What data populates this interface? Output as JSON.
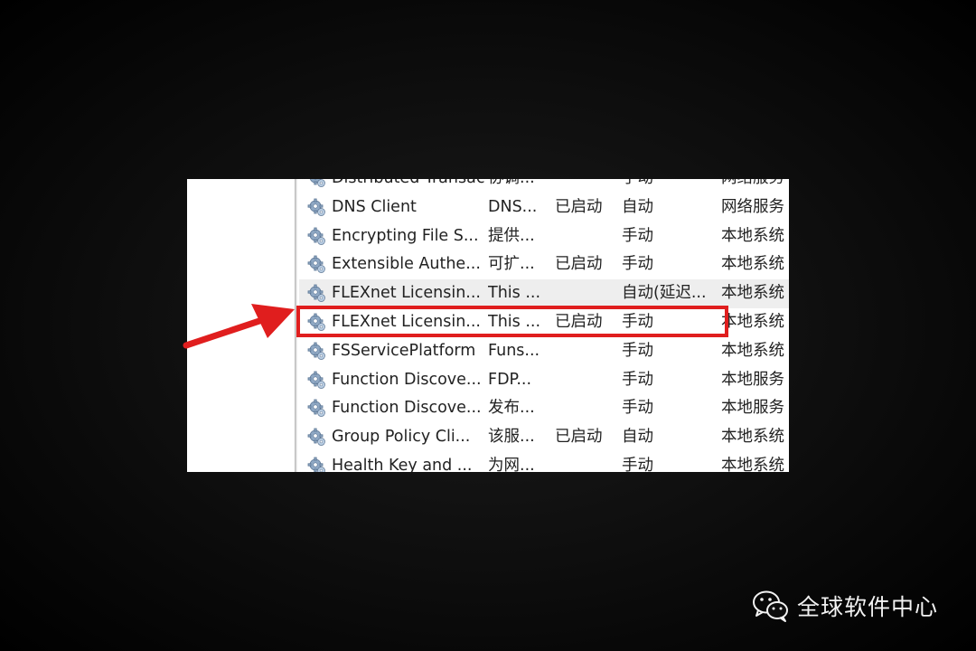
{
  "services": {
    "rows": [
      {
        "name": "Distributed Transaction...",
        "desc": "协调...",
        "status": "",
        "startup": "手动",
        "logon": "网络服务"
      },
      {
        "name": "DNS Client",
        "desc": "DNS...",
        "status": "已启动",
        "startup": "自动",
        "logon": "网络服务"
      },
      {
        "name": "Encrypting File S...",
        "desc": "提供...",
        "status": "",
        "startup": "手动",
        "logon": "本地系统"
      },
      {
        "name": "Extensible Authe...",
        "desc": "可扩...",
        "status": "已启动",
        "startup": "手动",
        "logon": "本地系统"
      },
      {
        "name": "FLEXnet Licensin...",
        "desc": "This ...",
        "status": "",
        "startup": "自动(延迟...",
        "logon": "本地系统"
      },
      {
        "name": "FLEXnet Licensin...",
        "desc": "This ...",
        "status": "已启动",
        "startup": "手动",
        "logon": "本地系统"
      },
      {
        "name": "FSServicePlatform",
        "desc": "Funs...",
        "status": "",
        "startup": "手动",
        "logon": "本地系统"
      },
      {
        "name": "Function Discove...",
        "desc": "FDP...",
        "status": "",
        "startup": "手动",
        "logon": "本地服务"
      },
      {
        "name": "Function Discove...",
        "desc": "发布...",
        "status": "",
        "startup": "手动",
        "logon": "本地服务"
      },
      {
        "name": "Group Policy Cli...",
        "desc": "该服...",
        "status": "已启动",
        "startup": "自动",
        "logon": "本地系统"
      },
      {
        "name": "Health Key and ...",
        "desc": "为网...",
        "status": "",
        "startup": "手动",
        "logon": "本地系统"
      }
    ]
  },
  "icons": {
    "service": "gear-icon",
    "pointer": "red-arrow-icon",
    "wechat": "wechat-icon"
  },
  "colors": {
    "highlight_box": "#e01e1e",
    "hover_row": "#eeeeee"
  },
  "watermark": {
    "text": "全球软件中心"
  }
}
